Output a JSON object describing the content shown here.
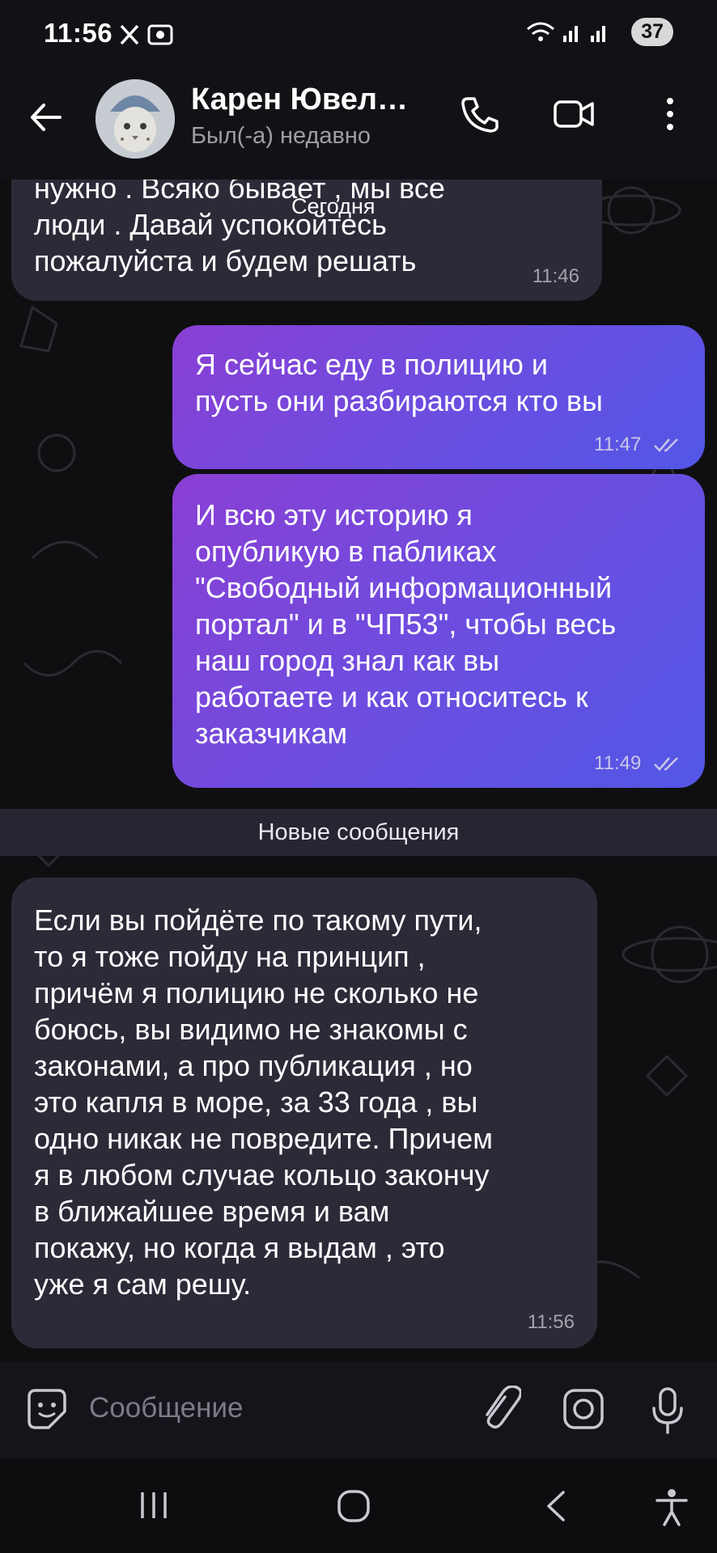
{
  "status_bar": {
    "time": "11:56",
    "battery": "37"
  },
  "header": {
    "contact_name": "Карен Ювел…",
    "contact_status": "Был(-а) недавно"
  },
  "chat": {
    "date_label": "Сегодня",
    "messages": [
      {
        "direction": "in",
        "text": "нужно . Всяко бывает , мы все\nлюди . Давай успокойтесь\nпожалуйста и будем решать",
        "time": "11:46"
      },
      {
        "direction": "out",
        "text": "Я сейчас еду в полицию и\nпусть они разбираются кто вы",
        "time": "11:47"
      },
      {
        "direction": "out",
        "text": "И всю эту историю я\nопубликую в пабликах\n\"Свободный информационный\nпортал\" и в \"ЧП53\", чтобы весь\nнаш город знал как вы\nработаете и как относитесь к\nзаказчикам",
        "time": "11:49"
      },
      {
        "direction": "in",
        "text": "Если вы пойдёте по такому пути,\nто я тоже пойду на принцип ,\nпричём я полицию не сколько не\nбоюсь, вы видимо не знакомы с\nзаконами, а про публикация , но\nэто капля в море, за 33 года , вы\nодно никак не повредите. Причем\nя в любом случае кольцо закончу\nв ближайшее время и вам\nпокажу, но когда я выдам , это\nуже я сам решу.",
        "time": "11:56"
      }
    ],
    "new_messages_label": "Новые сообщения"
  },
  "input": {
    "placeholder": "Сообщение"
  },
  "colors": {
    "background": "#0f0f12",
    "incoming_bubble": "#2b2b38",
    "outgoing_gradient_start": "#8a3fd4",
    "outgoing_gradient_end": "#5257e6"
  }
}
